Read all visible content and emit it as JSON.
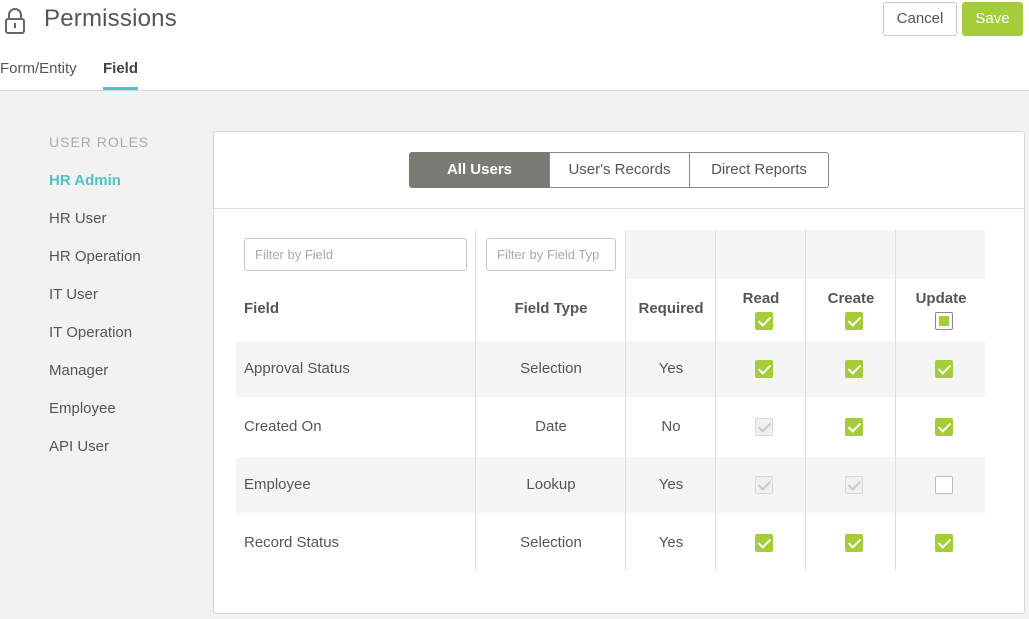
{
  "header": {
    "title": "Permissions",
    "cancel_label": "Cancel",
    "save_label": "Save",
    "tabs": [
      {
        "label": "Form/Entity"
      },
      {
        "label": "Field"
      }
    ]
  },
  "sidebar": {
    "heading": "USER ROLES",
    "roles": [
      {
        "label": "HR Admin",
        "active": true
      },
      {
        "label": "HR User"
      },
      {
        "label": "HR Operation"
      },
      {
        "label": "IT User"
      },
      {
        "label": "IT Operation"
      },
      {
        "label": "Manager"
      },
      {
        "label": "Employee"
      },
      {
        "label": "API User"
      }
    ]
  },
  "segments": [
    {
      "label": "All Users",
      "selected": true
    },
    {
      "label": "User's Records"
    },
    {
      "label": "Direct Reports"
    }
  ],
  "filters": {
    "field_placeholder": "Filter by Field",
    "type_placeholder": "Filter by Field Typ"
  },
  "columns": {
    "field": "Field",
    "field_type": "Field Type",
    "required": "Required",
    "read": "Read",
    "create": "Create",
    "update": "Update"
  },
  "header_checks": {
    "read": "on",
    "create": "on",
    "update": "partial"
  },
  "rows": [
    {
      "field": "Approval Status",
      "type": "Selection",
      "required": "Yes",
      "read": "on",
      "create": "on",
      "update": "on"
    },
    {
      "field": "Created On",
      "type": "Date",
      "required": "No",
      "read": "disabled",
      "create": "on",
      "update": "on"
    },
    {
      "field": "Employee",
      "type": "Lookup",
      "required": "Yes",
      "read": "disabled",
      "create": "disabled",
      "update": "off"
    },
    {
      "field": "Record Status",
      "type": "Selection",
      "required": "Yes",
      "read": "on",
      "create": "on",
      "update": "on"
    }
  ],
  "colors": {
    "accent": "#a4cd39",
    "active_role": "#4fc3c8",
    "segment_selected": "#7b7b76"
  }
}
